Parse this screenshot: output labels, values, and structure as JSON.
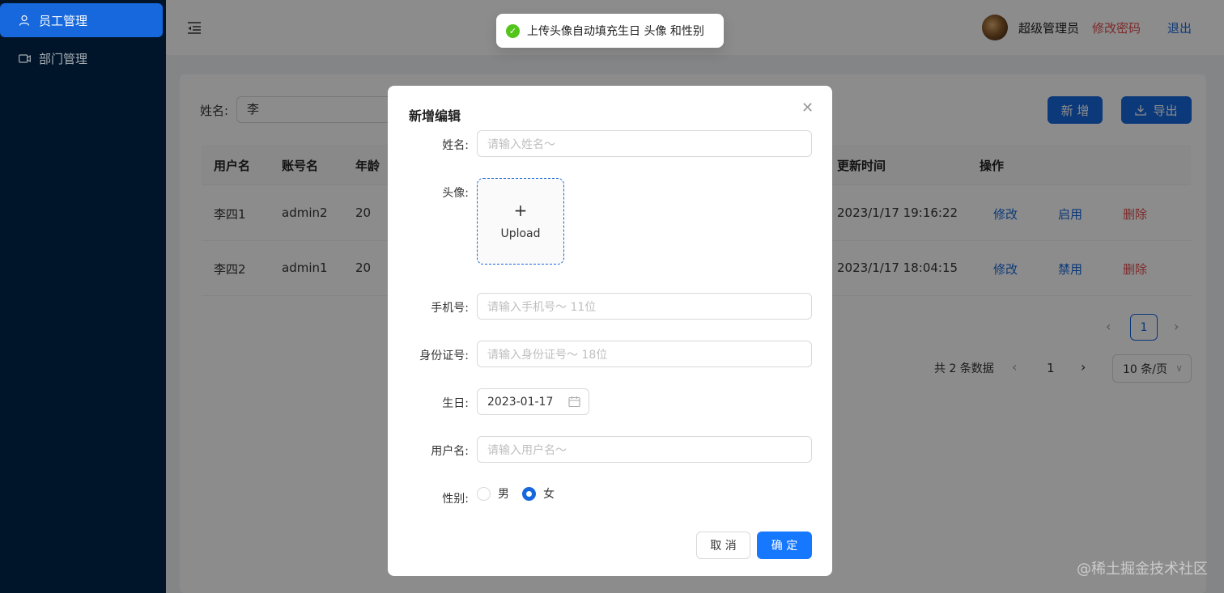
{
  "sidebar": {
    "items": [
      {
        "label": "员工管理",
        "icon": "user-icon",
        "active": true
      },
      {
        "label": "部门管理",
        "icon": "video-icon",
        "active": false
      }
    ]
  },
  "header": {
    "user_name": "超级管理员",
    "change_password": "修改密码",
    "logout": "退出"
  },
  "search": {
    "label": "姓名:",
    "value": "李"
  },
  "toolbar": {
    "add_label": "新 增",
    "export_label": "导出"
  },
  "table": {
    "columns": [
      "用户名",
      "账号名",
      "年龄",
      "更新时间",
      "操作"
    ],
    "rows": [
      {
        "username": "李四1",
        "account": "admin2",
        "age": "20",
        "updated": "2023/1/17 19:16:22",
        "edit": "修改",
        "toggle": "启用",
        "delete": "删除"
      },
      {
        "username": "李四2",
        "account": "admin1",
        "age": "20",
        "updated": "2023/1/17 18:04:15",
        "edit": "修改",
        "toggle": "禁用",
        "delete": "删除"
      }
    ]
  },
  "pagination": {
    "current_page": "1",
    "total_text": "共 2 条数据",
    "page_size": "10 条/页"
  },
  "toast": {
    "message": "上传头像自动填充生日 头像 和性别"
  },
  "modal": {
    "title": "新增编辑",
    "fields": {
      "name_label": "姓名:",
      "name_placeholder": "请输入姓名～",
      "avatar_label": "头像:",
      "upload_text": "Upload",
      "phone_label": "手机号:",
      "phone_placeholder": "请输入手机号～ 11位",
      "idcard_label": "身份证号:",
      "idcard_placeholder": "请输入身份证号～ 18位",
      "birthday_label": "生日:",
      "birthday_value": "2023-01-17",
      "username_label": "用户名:",
      "username_placeholder": "请输入用户名～",
      "gender_label": "性别:",
      "gender_options": [
        "男",
        "女"
      ],
      "gender_selected": "女"
    },
    "cancel_label": "取 消",
    "ok_label": "确 定"
  },
  "watermark": "@稀土掘金技术社区",
  "colors": {
    "sidebar_bg": "#001529",
    "primary": "#1668dc",
    "danger": "#e34d4d",
    "success": "#52c41a"
  }
}
